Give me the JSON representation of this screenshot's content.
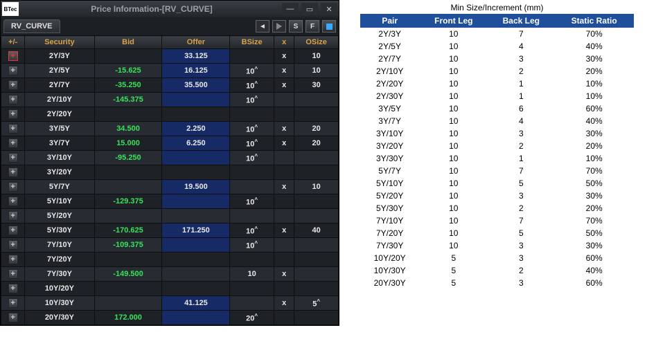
{
  "window": {
    "logo": "BTec",
    "title": "Price Information-[RV_CURVE]",
    "tab": "RV_CURVE",
    "btn_s": "S",
    "btn_f": "F"
  },
  "grid": {
    "headers": {
      "pm": "+/-",
      "sec": "Security",
      "bid": "Bid",
      "offer": "Offer",
      "bsize": "BSize",
      "x": "x",
      "osize": "OSize"
    },
    "rows": [
      {
        "pm": "red",
        "sec": "2Y/3Y",
        "bid": "",
        "offer": "33.125",
        "offerblue": true,
        "bsize": "",
        "x": "x",
        "osize": "10"
      },
      {
        "sec": "2Y/5Y",
        "bid": "-15.625",
        "offer": "16.125",
        "offerblue": true,
        "bsize": "10^",
        "x": "x",
        "osize": "10"
      },
      {
        "sec": "2Y/7Y",
        "bid": "-35.250",
        "offer": "35.500",
        "offerblue": true,
        "bsize": "10^",
        "x": "x",
        "osize": "30"
      },
      {
        "sec": "2Y/10Y",
        "bid": "-145.375",
        "offer": "",
        "offerblue": true,
        "bsize": "10^",
        "x": "",
        "osize": ""
      },
      {
        "sec": "2Y/20Y",
        "bid": "",
        "offer": "",
        "offerblue": false,
        "bsize": "",
        "x": "",
        "osize": ""
      },
      {
        "sec": "3Y/5Y",
        "bid": "34.500",
        "offer": "2.250",
        "offerblue": true,
        "bsize": "10^",
        "x": "x",
        "osize": "20"
      },
      {
        "sec": "3Y/7Y",
        "bid": "15.000",
        "offer": "6.250",
        "offerblue": true,
        "bsize": "10^",
        "x": "x",
        "osize": "20"
      },
      {
        "sec": "3Y/10Y",
        "bid": "-95.250",
        "offer": "",
        "offerblue": true,
        "bsize": "10^",
        "x": "",
        "osize": ""
      },
      {
        "sec": "3Y/20Y",
        "bid": "",
        "offer": "",
        "offerblue": false,
        "bsize": "",
        "x": "",
        "osize": ""
      },
      {
        "sec": "5Y/7Y",
        "bid": "",
        "offer": "19.500",
        "offerblue": true,
        "bsize": "",
        "x": "x",
        "osize": "10"
      },
      {
        "sec": "5Y/10Y",
        "bid": "-129.375",
        "offer": "",
        "offerblue": true,
        "bsize": "10^",
        "x": "",
        "osize": ""
      },
      {
        "sec": "5Y/20Y",
        "bid": "",
        "offer": "",
        "offerblue": false,
        "bsize": "",
        "x": "",
        "osize": ""
      },
      {
        "sec": "5Y/30Y",
        "bid": "-170.625",
        "offer": "171.250",
        "offerblue": true,
        "bsize": "10^",
        "x": "x",
        "osize": "40"
      },
      {
        "sec": "7Y/10Y",
        "bid": "-109.375",
        "offer": "",
        "offerblue": true,
        "bsize": "10^",
        "x": "",
        "osize": ""
      },
      {
        "sec": "7Y/20Y",
        "bid": "",
        "offer": "",
        "offerblue": false,
        "bsize": "",
        "x": "",
        "osize": ""
      },
      {
        "sec": "7Y/30Y",
        "bid": "-149.500",
        "offer": "",
        "offerblue": false,
        "bsize": "10",
        "x": "x",
        "osize": ""
      },
      {
        "sec": "10Y/20Y",
        "bid": "",
        "offer": "",
        "offerblue": false,
        "bsize": "",
        "x": "",
        "osize": ""
      },
      {
        "sec": "10Y/30Y",
        "bid": "",
        "offer": "41.125",
        "offerblue": true,
        "bsize": "",
        "x": "x",
        "osize": "5^",
        "osizegreen": true
      },
      {
        "sec": "20Y/30Y",
        "bid": "172.000",
        "offer": "",
        "offerblue": true,
        "bsize": "20^",
        "x": "",
        "osize": ""
      }
    ]
  },
  "sheet": {
    "suptitle": "Min Size/Increment (mm)",
    "headers": {
      "pair": "Pair",
      "front": "Front Leg",
      "back": "Back Leg",
      "ratio": "Static Ratio"
    },
    "rows": [
      {
        "pair": "2Y/3Y",
        "front": "10",
        "back": "7",
        "ratio": "70%"
      },
      {
        "pair": "2Y/5Y",
        "front": "10",
        "back": "4",
        "ratio": "40%"
      },
      {
        "pair": "2Y/7Y",
        "front": "10",
        "back": "3",
        "ratio": "30%"
      },
      {
        "pair": "2Y/10Y",
        "front": "10",
        "back": "2",
        "ratio": "20%"
      },
      {
        "pair": "2Y/20Y",
        "front": "10",
        "back": "1",
        "ratio": "10%"
      },
      {
        "pair": "2Y/30Y",
        "front": "10",
        "back": "1",
        "ratio": "10%"
      },
      {
        "pair": "3Y/5Y",
        "front": "10",
        "back": "6",
        "ratio": "60%"
      },
      {
        "pair": "3Y/7Y",
        "front": "10",
        "back": "4",
        "ratio": "40%"
      },
      {
        "pair": "3Y/10Y",
        "front": "10",
        "back": "3",
        "ratio": "30%"
      },
      {
        "pair": "3Y/20Y",
        "front": "10",
        "back": "2",
        "ratio": "20%"
      },
      {
        "pair": "3Y/30Y",
        "front": "10",
        "back": "1",
        "ratio": "10%"
      },
      {
        "pair": "5Y/7Y",
        "front": "10",
        "back": "7",
        "ratio": "70%"
      },
      {
        "pair": "5Y/10Y",
        "front": "10",
        "back": "5",
        "ratio": "50%"
      },
      {
        "pair": "5Y/20Y",
        "front": "10",
        "back": "3",
        "ratio": "30%"
      },
      {
        "pair": "5Y/30Y",
        "front": "10",
        "back": "2",
        "ratio": "20%"
      },
      {
        "pair": "7Y/10Y",
        "front": "10",
        "back": "7",
        "ratio": "70%"
      },
      {
        "pair": "7Y/20Y",
        "front": "10",
        "back": "5",
        "ratio": "50%"
      },
      {
        "pair": "7Y/30Y",
        "front": "10",
        "back": "3",
        "ratio": "30%"
      },
      {
        "pair": "10Y/20Y",
        "front": "5",
        "back": "3",
        "ratio": "60%"
      },
      {
        "pair": "10Y/30Y",
        "front": "5",
        "back": "2",
        "ratio": "40%"
      },
      {
        "pair": "20Y/30Y",
        "front": "5",
        "back": "3",
        "ratio": "60%"
      }
    ]
  }
}
